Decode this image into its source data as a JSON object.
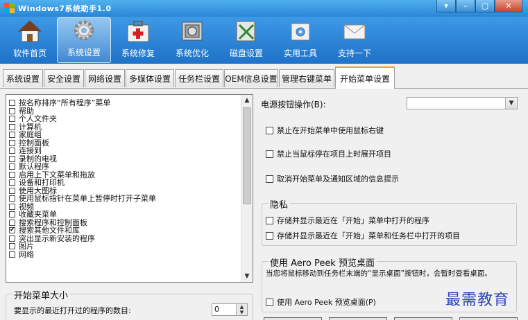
{
  "window": {
    "title": "Windows7系统助手1.0",
    "buttons": [
      "▾",
      "–",
      "▢",
      "✕"
    ]
  },
  "toolbar": {
    "items": [
      {
        "label": "软件首页",
        "icon": "home-icon"
      },
      {
        "label": "系统设置",
        "icon": "gear-icon",
        "active": true
      },
      {
        "label": "系统修复",
        "icon": "medkit-icon"
      },
      {
        "label": "系统优化",
        "icon": "optimize-icon"
      },
      {
        "label": "磁盘设置",
        "icon": "disk-icon"
      },
      {
        "label": "实用工具",
        "icon": "tools-icon"
      },
      {
        "label": "支持一下",
        "icon": "envelope-icon"
      }
    ]
  },
  "tabs": [
    {
      "label": "系统设置"
    },
    {
      "label": "安全设置"
    },
    {
      "label": "网络设置"
    },
    {
      "label": "多媒体设置"
    },
    {
      "label": "任务栏设置"
    },
    {
      "label": "OEM信息设置"
    },
    {
      "label": "管理右键菜单"
    },
    {
      "label": "开始菜单设置",
      "active": true
    }
  ],
  "start_menu_items": [
    {
      "label": "按名称排序“所有程序”菜单",
      "checked": false
    },
    {
      "label": "帮助",
      "checked": false
    },
    {
      "label": "个人文件夹",
      "checked": false
    },
    {
      "label": "计算机",
      "checked": false
    },
    {
      "label": "家庭组",
      "checked": false
    },
    {
      "label": "控制面板",
      "checked": false
    },
    {
      "label": "连接到",
      "checked": false
    },
    {
      "label": "录制的电视",
      "checked": false
    },
    {
      "label": "默认程序",
      "checked": false
    },
    {
      "label": "启用上下文菜单和拖放",
      "checked": false
    },
    {
      "label": "设备和打印机",
      "checked": false
    },
    {
      "label": "使用大图标",
      "checked": false
    },
    {
      "label": "使用鼠标指针在菜单上暂停时打开子菜单",
      "checked": false
    },
    {
      "label": "视频",
      "checked": false
    },
    {
      "label": "收藏夹菜单",
      "checked": false
    },
    {
      "label": "搜索程序和控制面板",
      "checked": false
    },
    {
      "label": "搜索其他文件和库",
      "checked": true
    },
    {
      "label": "突出显示新安装的程序",
      "checked": false
    },
    {
      "label": "图片",
      "checked": false
    },
    {
      "label": "网络",
      "checked": false
    }
  ],
  "start_menu_size": {
    "title": "开始菜单大小",
    "recent_label": "要显示的最近打开过的程序的数目:",
    "recent_value": "0"
  },
  "power_button": {
    "label": "电源按钮操作(B):",
    "value": ""
  },
  "options": [
    {
      "label": "禁止在开始菜单中使用鼠标右键",
      "checked": false
    },
    {
      "label": "禁止当鼠标停在项目上时展开项目",
      "checked": false
    },
    {
      "label": "取消开始菜单及通知区域的信息提示",
      "checked": false
    }
  ],
  "privacy": {
    "title": "隐私",
    "items": [
      {
        "label": "存储并显示最近在「开始」菜单中打开的程序",
        "checked": false
      },
      {
        "label": "存储并显示最近在「开始」菜单和任务栏中打开的项目",
        "checked": false
      }
    ]
  },
  "aero_peek": {
    "title": "使用 Aero Peek 预览桌面",
    "description": "当您将鼠标移动到任务栏末端的“显示桌面”按钮时，会暂时查看桌面。",
    "checkbox_label": "使用 Aero Peek 预览桌面(P)",
    "checked": false
  },
  "watermark": "最需教育",
  "colors": {
    "titlebar": "#2a86d6",
    "toolbar": "#1f72c8",
    "active_tab_accent": "#f0a030",
    "watermark": "#2c46b8"
  }
}
